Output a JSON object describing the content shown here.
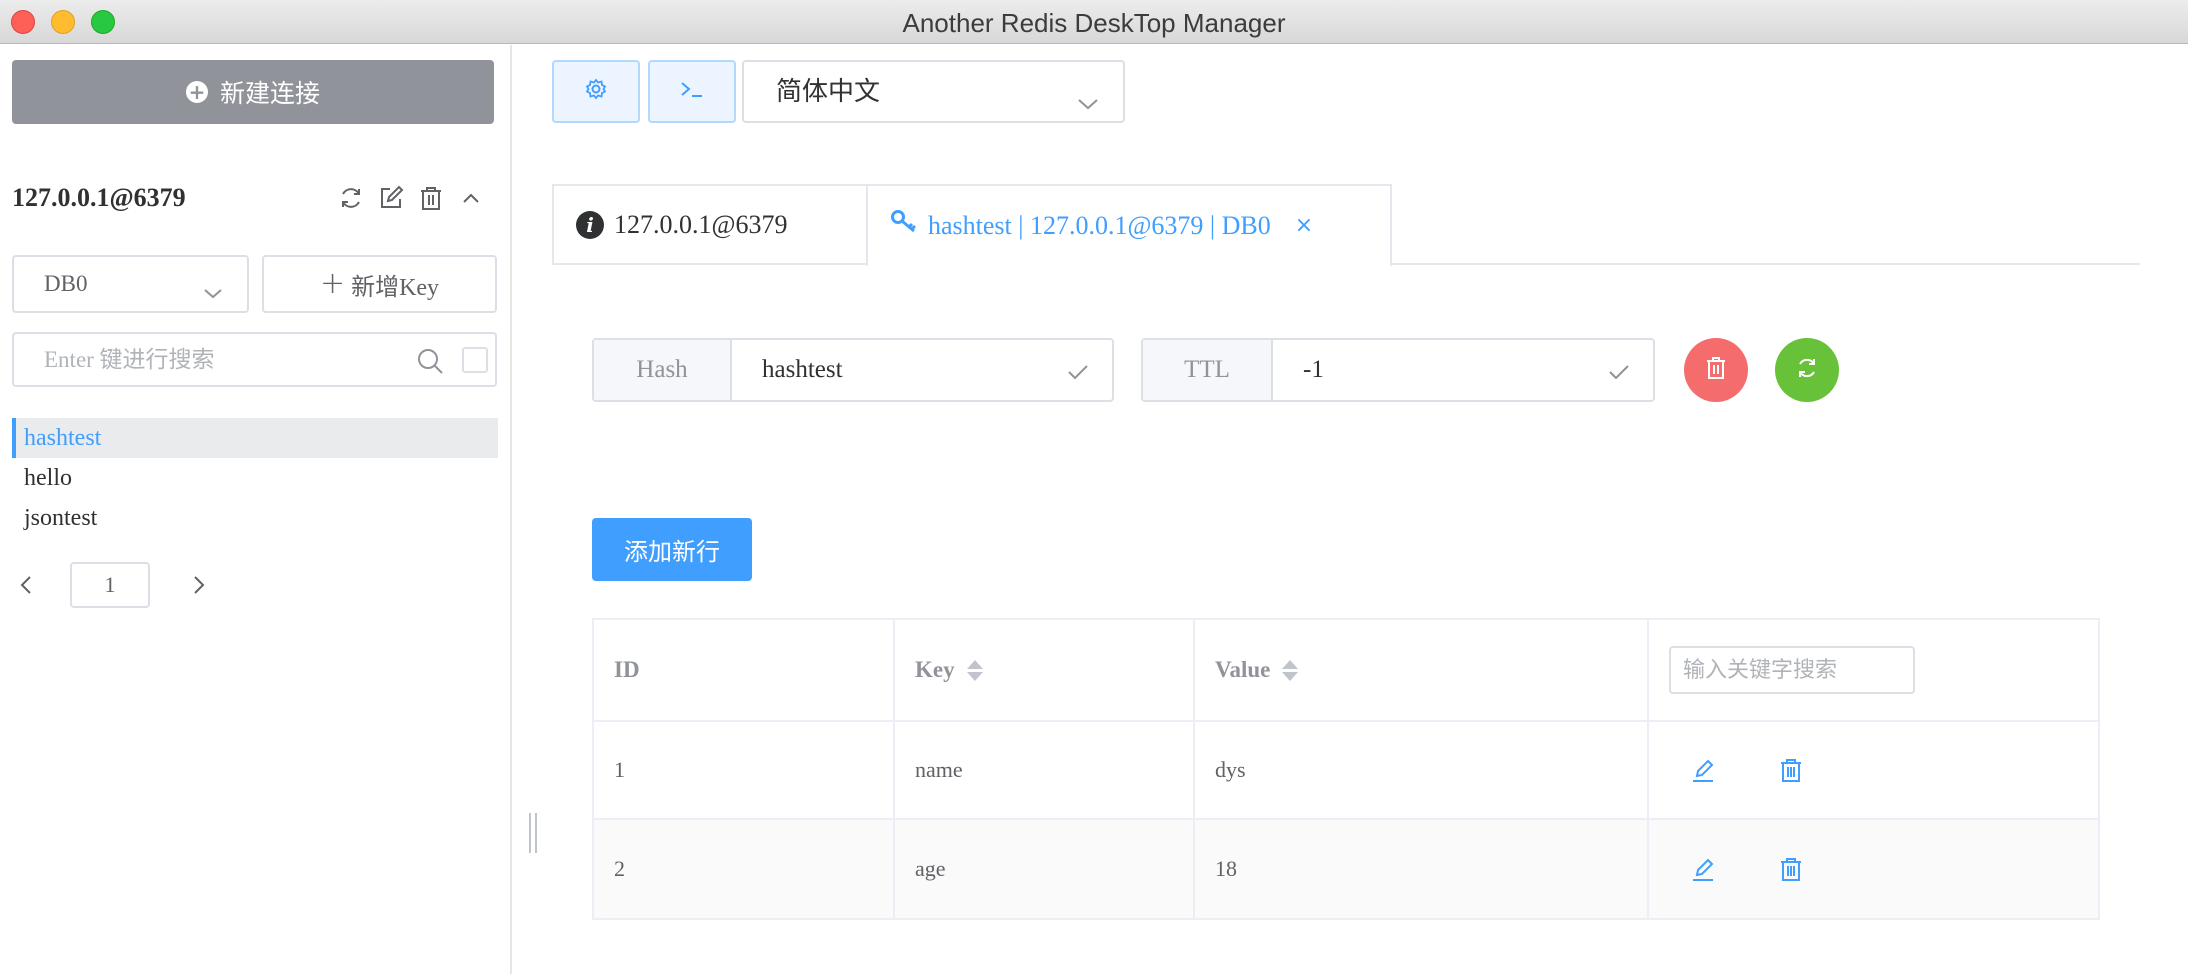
{
  "window": {
    "title": "Another Redis DeskTop Manager"
  },
  "sidebar": {
    "new_connection_label": "新建连接",
    "connection_name": "127.0.0.1@6379",
    "db_selected": "DB0",
    "new_key_label": "新增Key",
    "search_placeholder": "Enter 键进行搜索",
    "keys": [
      "hashtest",
      "hello",
      "jsontest"
    ],
    "active_key": "hashtest",
    "page": "1"
  },
  "toolbar": {
    "language_selected": "简体中文"
  },
  "tabs": [
    {
      "label": "127.0.0.1@6379",
      "icon": "info-icon"
    },
    {
      "label": "hashtest | 127.0.0.1@6379 | DB0",
      "icon": "key-icon",
      "close": "×"
    }
  ],
  "key_detail": {
    "type_label": "Hash",
    "key_name": "hashtest",
    "ttl_label": "TTL",
    "ttl_value": "-1",
    "add_row_label": "添加新行"
  },
  "table": {
    "headers": {
      "id": "ID",
      "key": "Key",
      "value": "Value"
    },
    "search_placeholder": "输入关键字搜索",
    "rows": [
      {
        "id": "1",
        "key": "name",
        "value": "dys"
      },
      {
        "id": "2",
        "key": "age",
        "value": "18"
      }
    ]
  },
  "colors": {
    "accent": "#409eff",
    "danger": "#f56c6c",
    "success": "#67c23a",
    "primary_dark": "#909399"
  }
}
